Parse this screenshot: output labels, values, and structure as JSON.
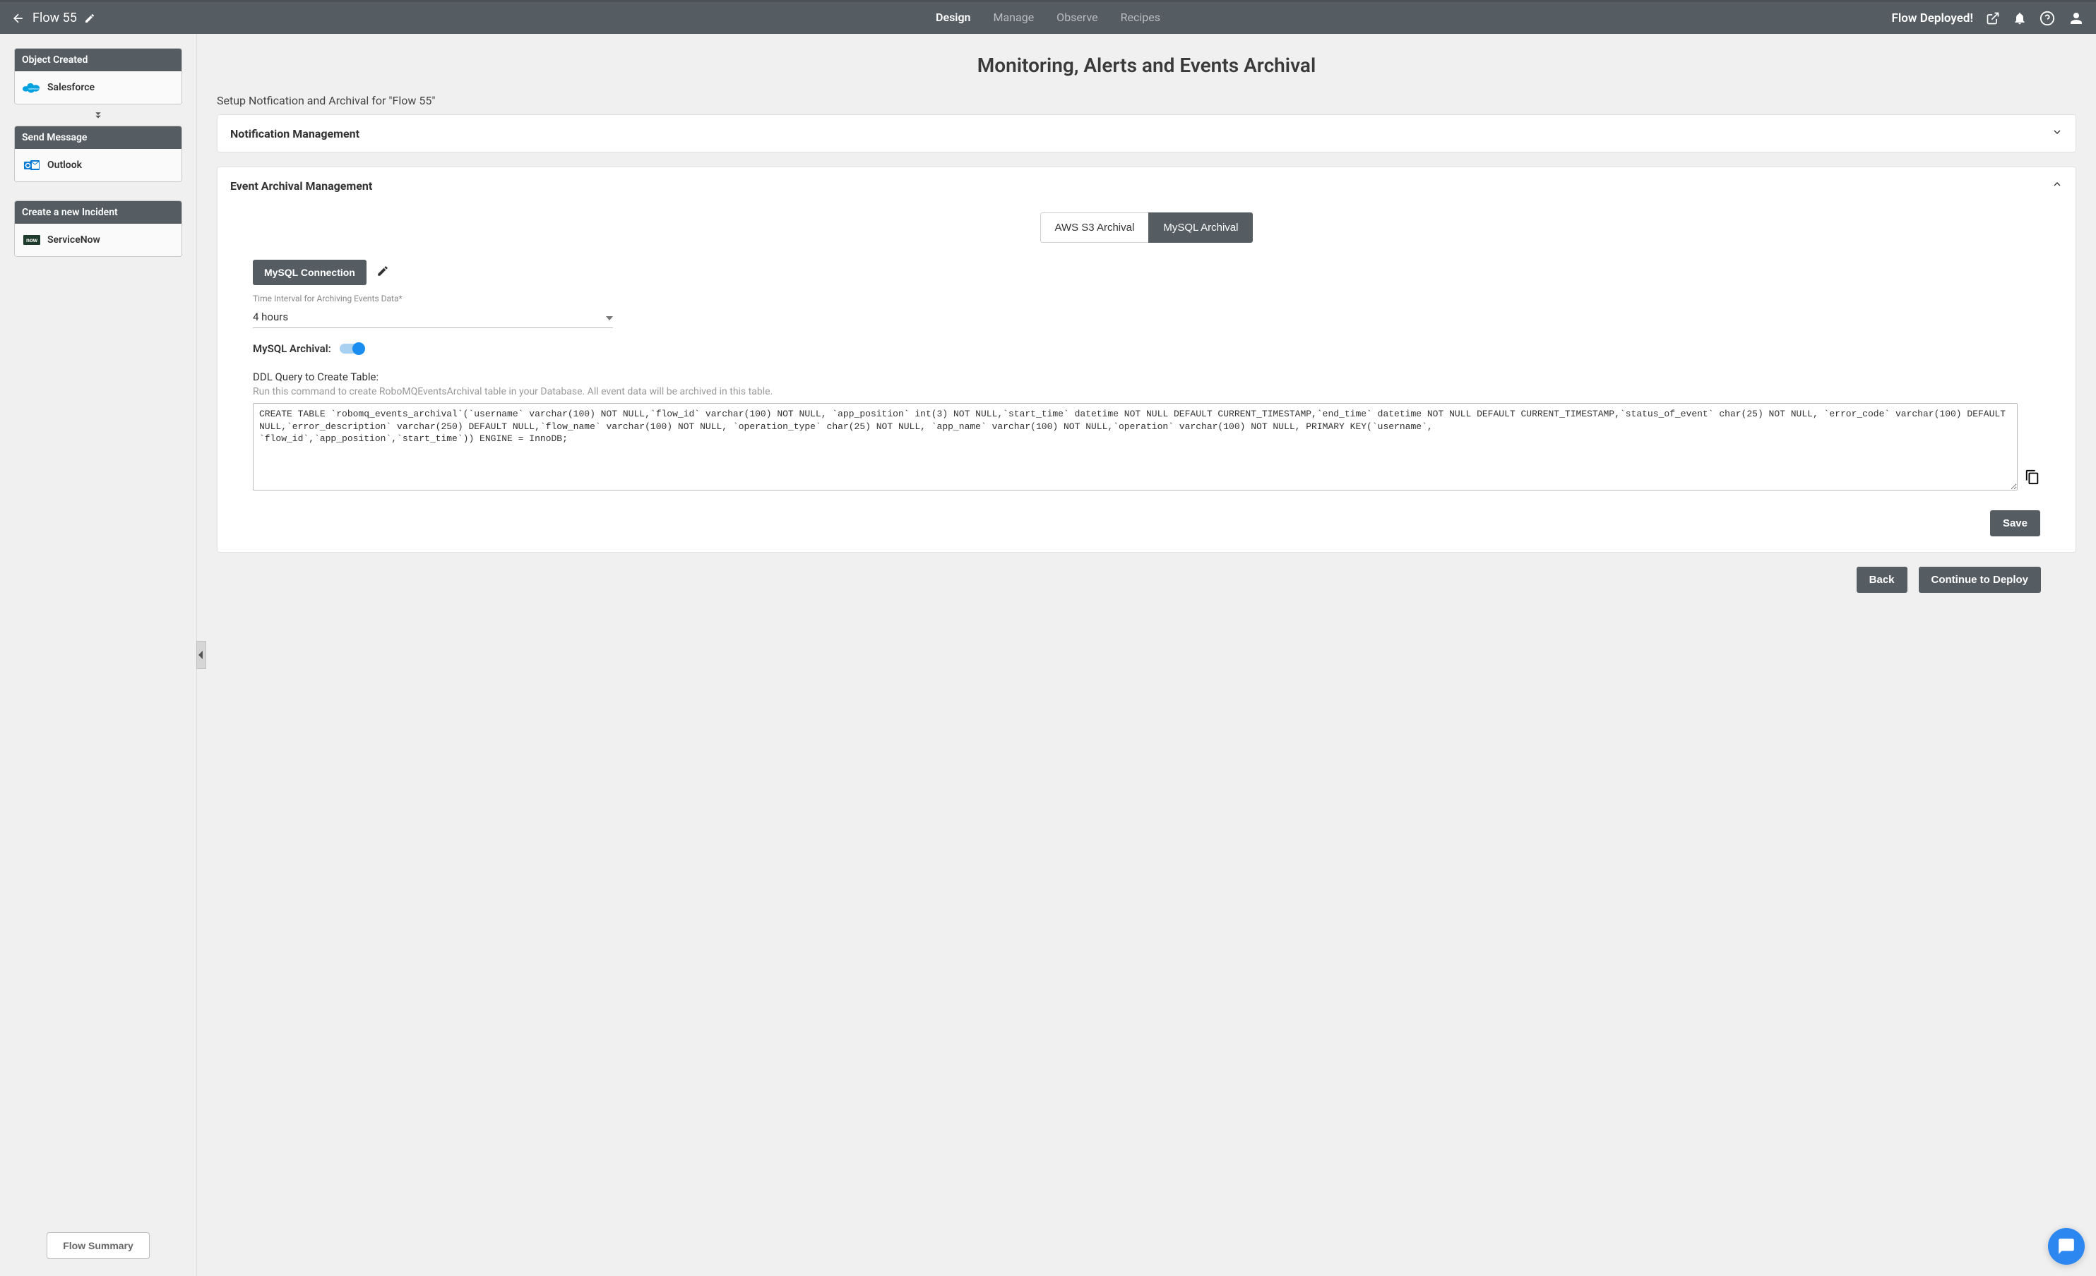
{
  "header": {
    "flow_name": "Flow 55",
    "nav": [
      "Design",
      "Manage",
      "Observe",
      "Recipes"
    ],
    "active_nav": "Design",
    "deploy_status": "Flow Deployed!"
  },
  "sidebar": {
    "nodes": [
      {
        "title": "Object Created",
        "app": "Salesforce",
        "logo_color": "#00a1e0"
      },
      {
        "title": "Send Message",
        "app": "Outlook",
        "logo_color": "#0078d4"
      },
      {
        "title": "Create a new Incident",
        "app": "ServiceNow",
        "logo_color": "#1f3b2e"
      }
    ],
    "summary_button": "Flow Summary"
  },
  "main": {
    "page_title": "Monitoring, Alerts and Events Archival",
    "subtitle": "Setup Notfication and Archival for \"Flow 55\"",
    "notification_panel": {
      "title": "Notification Management"
    },
    "archival_panel": {
      "title": "Event Archival Management",
      "tabs": [
        "AWS S3 Archival",
        "MySQL Archival"
      ],
      "active_tab": "MySQL Archival",
      "connection_button": "MySQL Connection",
      "interval_label": "Time Interval for Archiving Events Data*",
      "interval_value": "4 hours",
      "toggle_label": "MySQL Archival:",
      "toggle_on": true,
      "ddl_label": "DDL Query to Create Table:",
      "ddl_hint": "Run this command to create RoboMQEventsArchival table in your Database. All event data will be archived in this table.",
      "ddl_query": "CREATE TABLE `robomq_events_archival`(`username` varchar(100) NOT NULL,`flow_id` varchar(100) NOT NULL, `app_position` int(3) NOT NULL,`start_time` datetime NOT NULL DEFAULT CURRENT_TIMESTAMP,`end_time` datetime NOT NULL DEFAULT CURRENT_TIMESTAMP,`status_of_event` char(25) NOT NULL, `error_code` varchar(100) DEFAULT NULL,`error_description` varchar(250) DEFAULT NULL,`flow_name` varchar(100) NOT NULL, `operation_type` char(25) NOT NULL, `app_name` varchar(100) NOT NULL,`operation` varchar(100) NOT NULL, PRIMARY KEY(`username`,\n`flow_id`,`app_position`,`start_time`)) ENGINE = InnoDB;",
      "save_button": "Save"
    },
    "actions": {
      "back": "Back",
      "continue": "Continue to Deploy"
    }
  }
}
